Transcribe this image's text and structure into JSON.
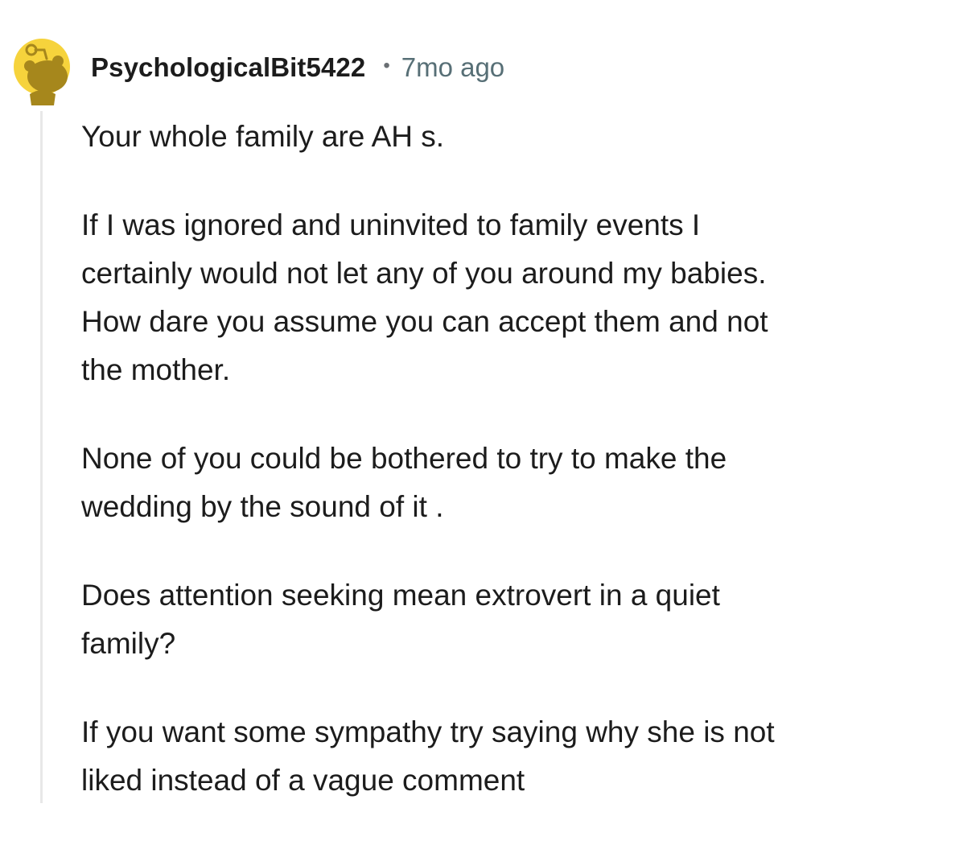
{
  "comment": {
    "author": "PsychologicalBit5422",
    "separator": "•",
    "timestamp": "7mo ago",
    "avatar_icon": "reddit-snoo-avatar-icon",
    "colors": {
      "avatar_background": "#f6d33c",
      "avatar_figure": "#a6871c",
      "thread_line": "#e8e8e8",
      "timestamp": "#576f76"
    },
    "paragraphs": [
      "Your whole family are AH s.",
      "If I was ignored and uninvited to family events I\ncertainly would not let any of you around my babies.\nHow dare you assume you can accept them and not\nthe mother.",
      "None of you could be bothered to try to make the\nwedding by the sound of it .",
      "Does attention seeking mean extrovert in a quiet\nfamily?",
      "If you want some sympathy try saying why she is not\nliked instead of a vague comment"
    ]
  }
}
